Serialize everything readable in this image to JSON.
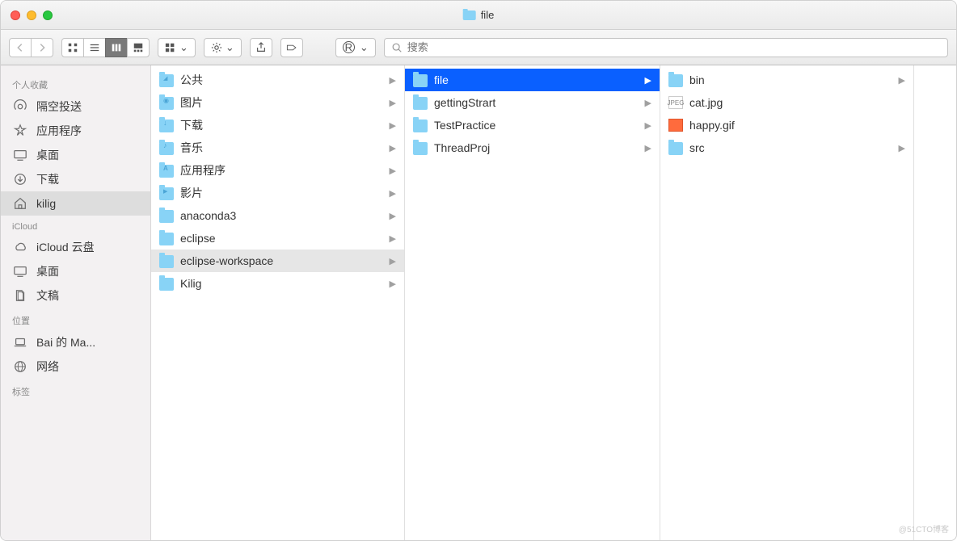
{
  "window": {
    "title": "file"
  },
  "search": {
    "placeholder": "搜索"
  },
  "sidebar": {
    "sections": [
      {
        "heading": "个人收藏",
        "items": [
          {
            "icon": "airdrop",
            "label": "隔空投送",
            "selected": false
          },
          {
            "icon": "apps",
            "label": "应用程序",
            "selected": false
          },
          {
            "icon": "desktop",
            "label": "桌面",
            "selected": false
          },
          {
            "icon": "downloads",
            "label": "下载",
            "selected": false
          },
          {
            "icon": "home",
            "label": "kilig",
            "selected": true
          }
        ]
      },
      {
        "heading": "iCloud",
        "items": [
          {
            "icon": "cloud",
            "label": "iCloud 云盘",
            "selected": false
          },
          {
            "icon": "desktop",
            "label": "桌面",
            "selected": false
          },
          {
            "icon": "docs",
            "label": "文稿",
            "selected": false
          }
        ]
      },
      {
        "heading": "位置",
        "items": [
          {
            "icon": "laptop",
            "label": "Bai 的 Ma...",
            "selected": false
          },
          {
            "icon": "network",
            "label": "网络",
            "selected": false
          }
        ]
      },
      {
        "heading": "标签",
        "items": []
      }
    ]
  },
  "columns": [
    {
      "items": [
        {
          "type": "folder",
          "variant": "public",
          "name": "公共",
          "hasChildren": true
        },
        {
          "type": "folder",
          "variant": "pic",
          "name": "图片",
          "hasChildren": true
        },
        {
          "type": "folder",
          "variant": "arrow",
          "name": "下载",
          "hasChildren": true
        },
        {
          "type": "folder",
          "variant": "music",
          "name": "音乐",
          "hasChildren": true
        },
        {
          "type": "folder",
          "variant": "app",
          "name": "应用程序",
          "hasChildren": true
        },
        {
          "type": "folder",
          "variant": "movie",
          "name": "影片",
          "hasChildren": true
        },
        {
          "type": "folder",
          "variant": "",
          "name": "anaconda3",
          "hasChildren": true
        },
        {
          "type": "folder",
          "variant": "",
          "name": "eclipse",
          "hasChildren": true
        },
        {
          "type": "folder",
          "variant": "",
          "name": "eclipse-workspace",
          "hasChildren": true,
          "selected": "light"
        },
        {
          "type": "folder",
          "variant": "",
          "name": "Kilig",
          "hasChildren": true
        }
      ]
    },
    {
      "items": [
        {
          "type": "folder",
          "variant": "",
          "name": "file",
          "hasChildren": true,
          "selected": "blue"
        },
        {
          "type": "folder",
          "variant": "",
          "name": "gettingStrart",
          "hasChildren": true
        },
        {
          "type": "folder",
          "variant": "",
          "name": "TestPractice",
          "hasChildren": true
        },
        {
          "type": "folder",
          "variant": "",
          "name": "ThreadProj",
          "hasChildren": true
        }
      ]
    },
    {
      "items": [
        {
          "type": "folder",
          "variant": "",
          "name": "bin",
          "hasChildren": true
        },
        {
          "type": "image",
          "variant": "jpeg",
          "name": "cat.jpg",
          "hasChildren": false
        },
        {
          "type": "image",
          "variant": "gif",
          "name": "happy.gif",
          "hasChildren": false
        },
        {
          "type": "folder",
          "variant": "",
          "name": "src",
          "hasChildren": true
        }
      ]
    }
  ],
  "watermark": "@51CTO博客"
}
